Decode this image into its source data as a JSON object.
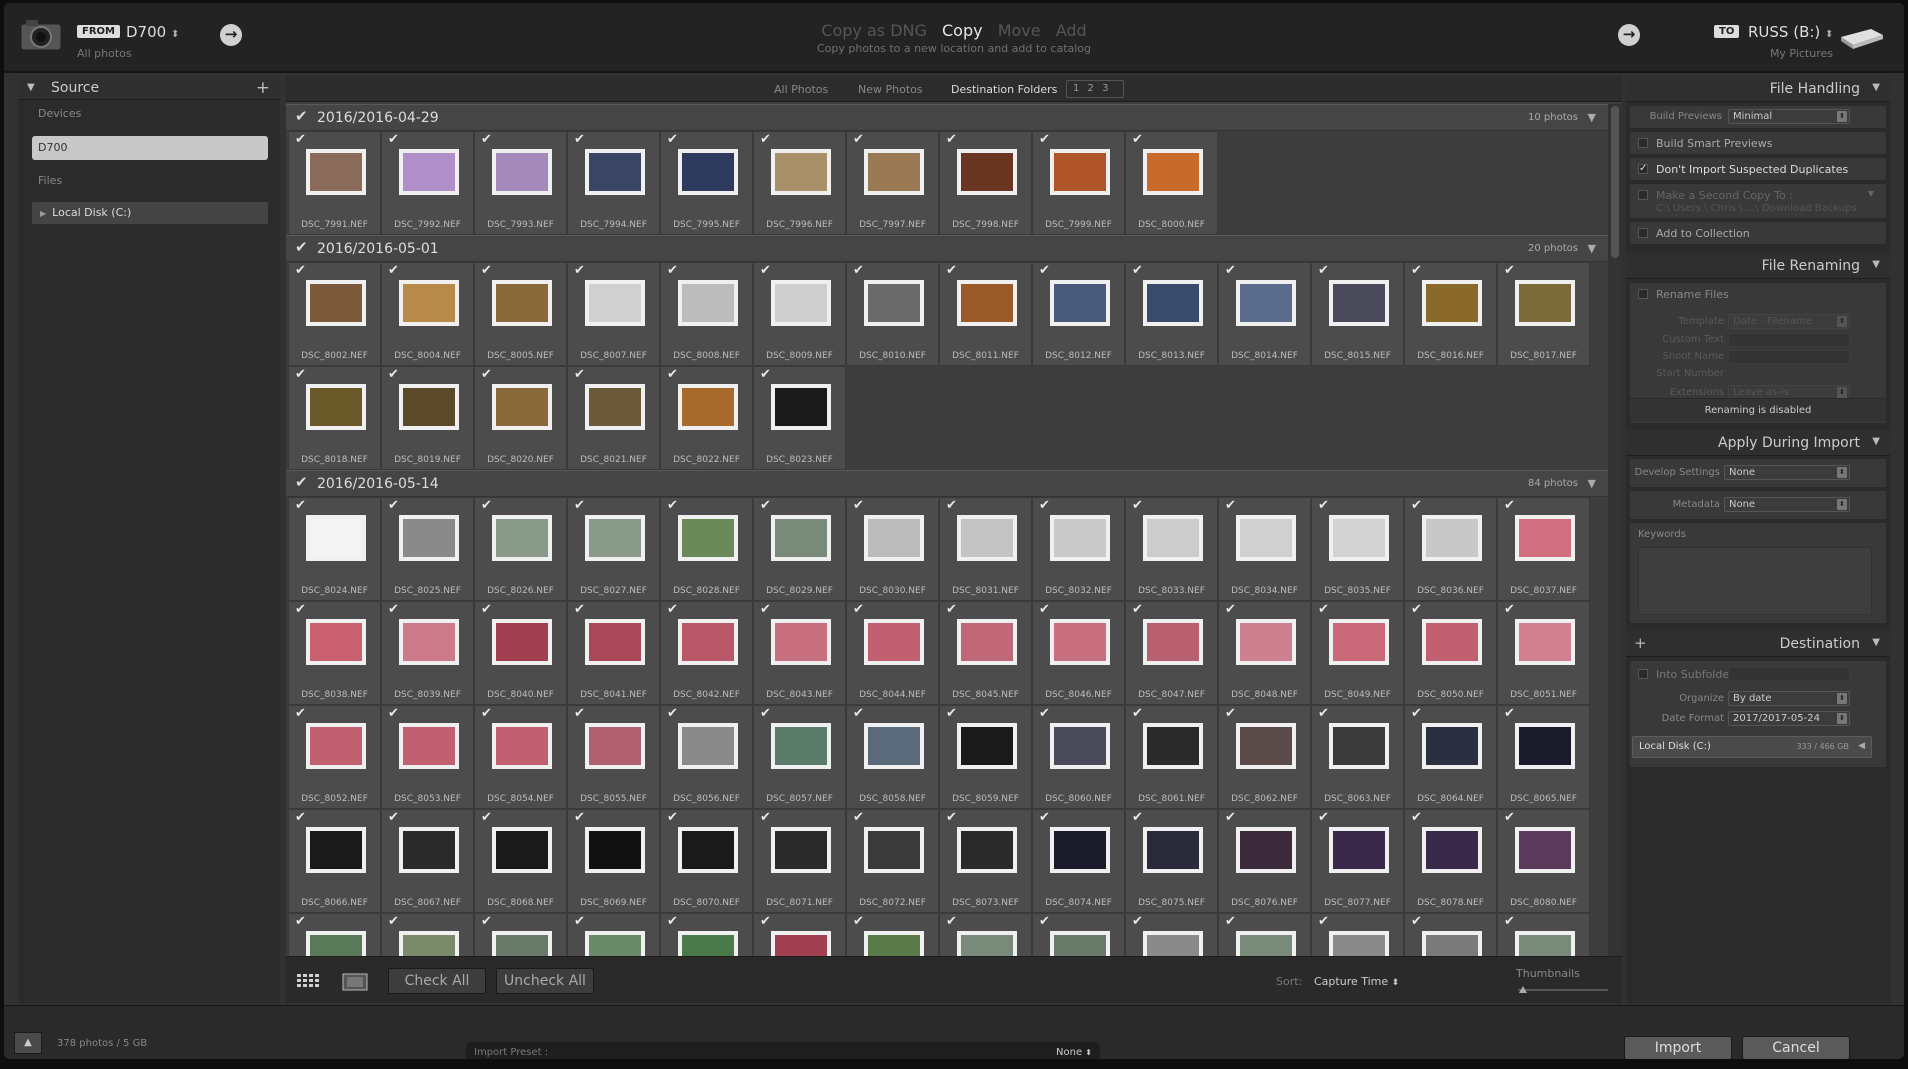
{
  "header": {
    "from_tag": "FROM",
    "source_name": "D700",
    "source_sub": "All photos",
    "modes": [
      "Copy as DNG",
      "Copy",
      "Move",
      "Add"
    ],
    "mode_description": "Copy photos to a new location and add to catalog",
    "to_tag": "TO",
    "dest_name": "RUSS (B:)",
    "dest_sub": "My Pictures"
  },
  "source_panel": {
    "title": "Source",
    "devices_label": "Devices",
    "device": "D700",
    "files_label": "Files",
    "local_disk": "Local Disk (C:)"
  },
  "view_tabs": {
    "all": "All Photos",
    "new": "New Photos",
    "dest": "Destination Folders",
    "pages": "1 2 3"
  },
  "groups": [
    {
      "title": "2016/2016-04-29",
      "count": "10 photos",
      "files": [
        "DSC_7991.NEF",
        "DSC_7992.NEF",
        "DSC_7993.NEF",
        "DSC_7994.NEF",
        "DSC_7995.NEF",
        "DSC_7996.NEF",
        "DSC_7997.NEF",
        "DSC_7998.NEF",
        "DSC_7999.NEF",
        "DSC_8000.NEF"
      ],
      "colors": [
        "#8a6a5a",
        "#b08ec8",
        "#a48abb",
        "#3a4566",
        "#2e3a5e",
        "#a8906a",
        "#9a7a55",
        "#6a3520",
        "#b0552a",
        "#c86a2a"
      ]
    },
    {
      "title": "2016/2016-05-01",
      "count": "20 photos",
      "files": [
        "DSC_8002.NEF",
        "DSC_8004.NEF",
        "DSC_8005.NEF",
        "DSC_8007.NEF",
        "DSC_8008.NEF",
        "DSC_8009.NEF",
        "DSC_8010.NEF",
        "DSC_8011.NEF",
        "DSC_8012.NEF",
        "DSC_8013.NEF",
        "DSC_8014.NEF",
        "DSC_8015.NEF",
        "DSC_8016.NEF",
        "DSC_8017.NEF",
        "DSC_8018.NEF",
        "DSC_8019.NEF",
        "DSC_8020.NEF",
        "DSC_8021.NEF",
        "DSC_8022.NEF",
        "DSC_8023.NEF"
      ],
      "colors": [
        "#7a5a3a",
        "#b88a4a",
        "#8a6a3a",
        "#d0d0d0",
        "#bcbcbc",
        "#cfcfcf",
        "#6a6a6a",
        "#9a5a2a",
        "#4a5a7a",
        "#3a4a6a",
        "#5a6a8a",
        "#4a4a5a",
        "#8a6a2a",
        "#7a6a3a",
        "#6a5a2a",
        "#5a4a2a",
        "#8a6a3a",
        "#6a5a3a",
        "#a86a2a",
        "#1a1a1a"
      ]
    },
    {
      "title": "2016/2016-05-14",
      "count": "84 photos",
      "files": [
        "DSC_8024.NEF",
        "DSC_8025.NEF",
        "DSC_8026.NEF",
        "DSC_8027.NEF",
        "DSC_8028.NEF",
        "DSC_8029.NEF",
        "DSC_8030.NEF",
        "DSC_8031.NEF",
        "DSC_8032.NEF",
        "DSC_8033.NEF",
        "DSC_8034.NEF",
        "DSC_8035.NEF",
        "DSC_8036.NEF",
        "DSC_8037.NEF",
        "DSC_8038.NEF",
        "DSC_8039.NEF",
        "DSC_8040.NEF",
        "DSC_8041.NEF",
        "DSC_8042.NEF",
        "DSC_8043.NEF",
        "DSC_8044.NEF",
        "DSC_8045.NEF",
        "DSC_8046.NEF",
        "DSC_8047.NEF",
        "DSC_8048.NEF",
        "DSC_8049.NEF",
        "DSC_8050.NEF",
        "DSC_8051.NEF",
        "DSC_8052.NEF",
        "DSC_8053.NEF",
        "DSC_8054.NEF",
        "DSC_8055.NEF",
        "DSC_8056.NEF",
        "DSC_8057.NEF",
        "DSC_8058.NEF",
        "DSC_8059.NEF",
        "DSC_8060.NEF",
        "DSC_8061.NEF",
        "DSC_8062.NEF",
        "DSC_8063.NEF",
        "DSC_8064.NEF",
        "DSC_8065.NEF",
        "DSC_8066.NEF",
        "DSC_8067.NEF",
        "DSC_8068.NEF",
        "DSC_8069.NEF",
        "DSC_8070.NEF",
        "DSC_8071.NEF",
        "DSC_8072.NEF",
        "DSC_8073.NEF",
        "DSC_8074.NEF",
        "DSC_8075.NEF",
        "DSC_8076.NEF",
        "DSC_8077.NEF",
        "DSC_8078.NEF",
        "DSC_8080.NEF",
        "",
        "",
        "",
        "",
        "",
        "",
        "",
        "",
        "",
        "",
        "",
        "",
        "",
        ""
      ],
      "colors": [
        "#f4f4f4",
        "#8a8a8a",
        "#8a9a8a",
        "#8a9a8a",
        "#6a8a5a",
        "#7a8a7a",
        "#bcbcbc",
        "#c4c4c4",
        "#cacaca",
        "#cccccc",
        "#d0d0d0",
        "#d2d2d2",
        "#c8c8c8",
        "#d07080",
        "#c86070",
        "#cc7a8a",
        "#a04050",
        "#a84858",
        "#b85868",
        "#c87080",
        "#c06070",
        "#c06878",
        "#c87080",
        "#b86070",
        "#cc8090",
        "#c86878",
        "#c06070",
        "#d08090",
        "#c06070",
        "#c06070",
        "#c06070",
        "#b06070",
        "#8a8a8a",
        "#5a7a6a",
        "#5a6a7a",
        "#1a1a1a",
        "#4a4a5a",
        "#2a2a2a",
        "#5a4a4a",
        "#3a3a3a",
        "#2a3040",
        "#1a1a2a",
        "#1a1a1a",
        "#2a2a2a",
        "#1a1a1a",
        "#111111",
        "#1a1a1a",
        "#2a2a2a",
        "#3a3a3a",
        "#2a2a2a",
        "#1a1a2a",
        "#2a2a3a",
        "#3a2a3a",
        "#3a2a4a",
        "#3a2a4a",
        "#5a3a5a",
        "#5a7a5a",
        "#7a8a6a",
        "#6a7a6a",
        "#6a8a6a",
        "#4a7a4a",
        "#a04050",
        "#5a7a4a",
        "#7a8a7a",
        "#6a7a6a",
        "#8a8a8a",
        "#7a8a7a",
        "#8a8a8a",
        "#7a7a7a",
        "#7a8a7a"
      ]
    }
  ],
  "toolbar": {
    "check_all": "Check All",
    "uncheck_all": "Uncheck All",
    "sort_label": "Sort:",
    "sort_value": "Capture Time",
    "thumbnails_label": "Thumbnails",
    "thumbnail_size": 0.05
  },
  "file_handling": {
    "title": "File Handling",
    "build_previews_label": "Build Previews",
    "build_previews_value": "Minimal",
    "smart_previews": "Build Smart Previews",
    "dont_import_dupes": "Don't Import Suspected Duplicates",
    "second_copy": "Make a Second Copy To :",
    "second_copy_path": "C:\\ Users \\ Chris \\ ...\\ Download Backups",
    "add_to_collection": "Add to Collection"
  },
  "file_renaming": {
    "title": "File Renaming",
    "rename_files": "Rename Files",
    "template_label": "Template",
    "template_value": "Date - Filename",
    "custom_text_label": "Custom Text",
    "shoot_name_label": "Shoot Name",
    "start_number_label": "Start Number",
    "extensions_label": "Extensions",
    "extensions_value": "Leave as-is",
    "disabled_note": "Renaming is disabled"
  },
  "apply_during_import": {
    "title": "Apply During Import",
    "develop_label": "Develop Settings",
    "develop_value": "None",
    "metadata_label": "Metadata",
    "metadata_value": "None",
    "keywords_label": "Keywords"
  },
  "destination": {
    "title": "Destination",
    "into_subfolder": "Into Subfolder",
    "organize_label": "Organize",
    "organize_value": "By date",
    "date_format_label": "Date Format",
    "date_format_value": "2017/2017-05-24",
    "disk_name": "Local Disk (C:)",
    "disk_space": "333 / 466 GB"
  },
  "status": {
    "photo_count": "378 photos / 5 GB",
    "preset_label": "Import Preset :",
    "preset_value": "None",
    "import": "Import",
    "cancel": "Cancel"
  }
}
